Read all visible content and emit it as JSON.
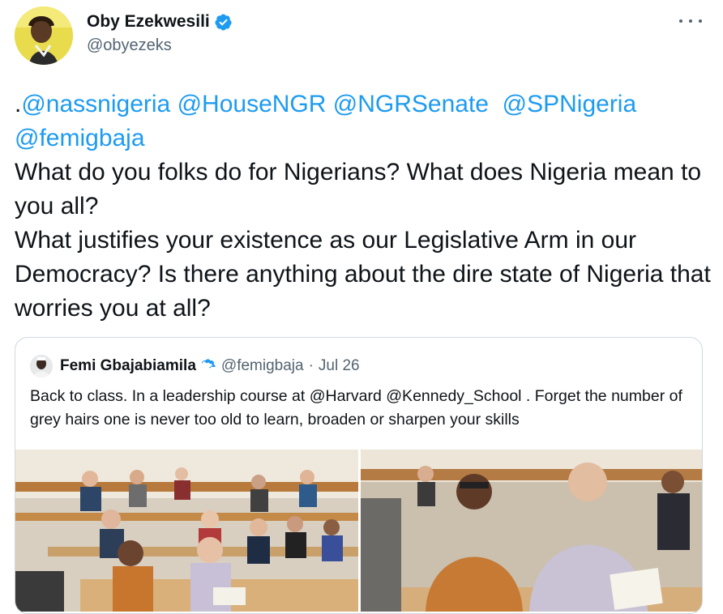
{
  "author": {
    "name": "Oby Ezekwesili",
    "handle": "@obyezeks",
    "verified_icon": "verified-badge-icon",
    "avatar_icon": "avatar"
  },
  "more_icon": "more-options-icon",
  "tweet": {
    "segments": [
      {
        "text": ".",
        "mention": false
      },
      {
        "text": "@nassnigeria",
        "mention": true
      },
      {
        "text": " ",
        "mention": false
      },
      {
        "text": "@HouseNGR",
        "mention": true
      },
      {
        "text": " ",
        "mention": false
      },
      {
        "text": "@NGRSenate",
        "mention": true
      },
      {
        "text": "  ",
        "mention": false
      },
      {
        "text": "@SPNigeria",
        "mention": true
      },
      {
        "text": "\n",
        "mention": false
      },
      {
        "text": "@femigbaja",
        "mention": true
      },
      {
        "text": "\nWhat do you folks do for Nigerians? What does Nigeria mean to you all?\nWhat justifies your existence as our Legislative Arm in our Democracy? Is there anything about the dire state of Nigeria that worries you at all?",
        "mention": false
      }
    ]
  },
  "quote": {
    "name": "Femi Gbajabiamila",
    "handle": "@femigbaja",
    "separator": "·",
    "date": "Jul 26",
    "text_segments": [
      {
        "text": "Back to class. In a leadership course at ",
        "mention": false
      },
      {
        "text": "@Harvard",
        "mention": false
      },
      {
        "text": " ",
        "mention": false
      },
      {
        "text": "@Kennedy_School",
        "mention": false
      },
      {
        "text": " . Forget the number of grey hairs one is never too old to learn, broaden or sharpen your skills",
        "mention": false
      }
    ],
    "photos": [
      {
        "alt_icon": "classroom-photo-1"
      },
      {
        "alt_icon": "classroom-photo-2"
      }
    ]
  },
  "colors": {
    "accent": "#1d9bf0",
    "text": "#0f1419",
    "secondary": "#536471",
    "border": "#cfd9de"
  }
}
